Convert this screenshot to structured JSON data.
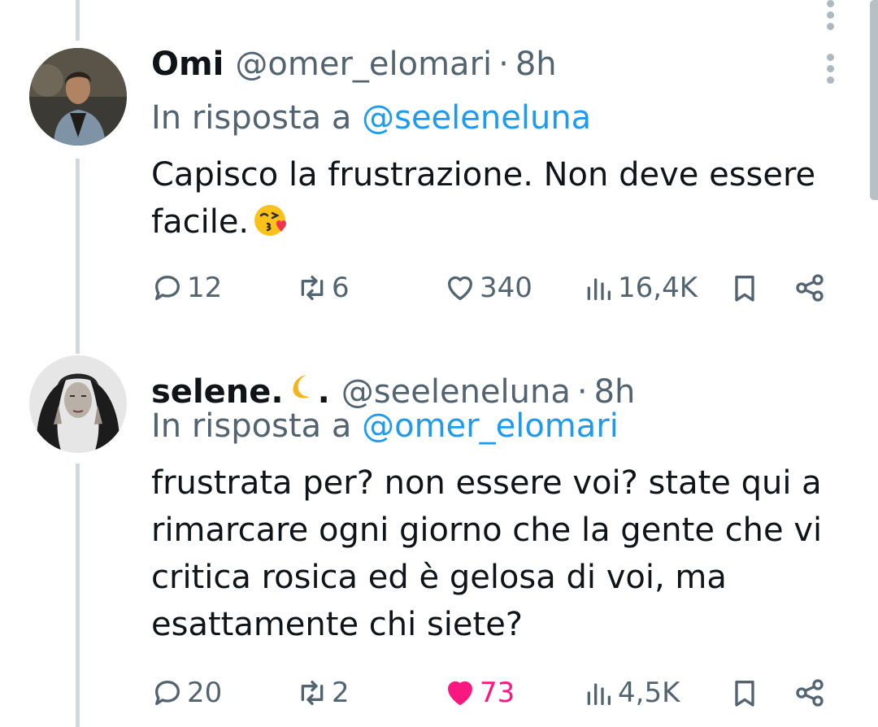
{
  "tweets": [
    {
      "name": "Omi",
      "handle": "@omer_elomari",
      "separator": "·",
      "time": "8h",
      "reply_prefix": "In risposta a",
      "reply_handle": "@seeleneluna",
      "text": "Capisco la frustrazione. Non deve essere facile.",
      "emoji": "kissing-face-with-heart-emoji",
      "replies": "12",
      "retweets": "6",
      "likes": "340",
      "views": "16,4K",
      "liked": false
    },
    {
      "name": "selene.",
      "name_suffix": ".",
      "name_emoji": "crescent-moon-emoji",
      "handle": "@seeleneluna",
      "separator": "·",
      "time": "8h",
      "reply_prefix": "In risposta a",
      "reply_handle": "@omer_elomari",
      "text": "frustrata per? non essere voi? state qui a rimarcare ogni giorno che la gente che vi critica rosica ed è  gelosa di voi, ma esattamente chi siete?",
      "replies": "20",
      "retweets": "2",
      "likes": "73",
      "views": "4,5K",
      "liked": true
    }
  ],
  "colors": {
    "text": "#0f1419",
    "secondary": "#536471",
    "mention": "#1d9bf0",
    "like": "#f91880",
    "thread_line": "#cfd9de"
  }
}
